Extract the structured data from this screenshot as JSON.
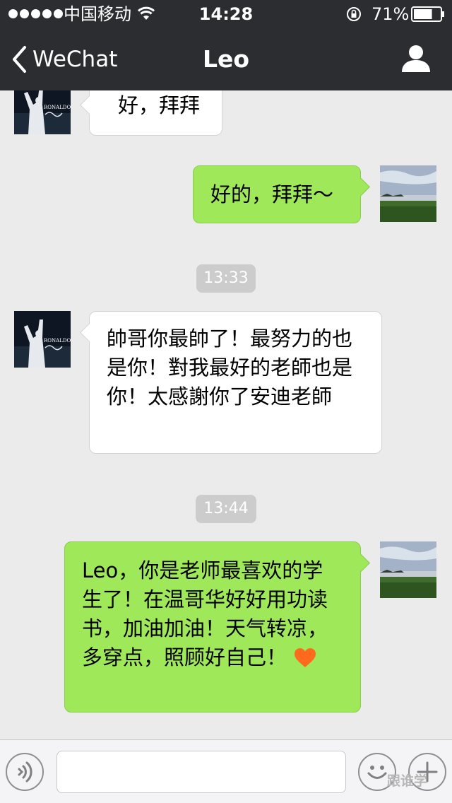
{
  "status_bar": {
    "carrier": "中国移动",
    "time": "14:28",
    "battery_percent": "71%",
    "battery_level": 0.71
  },
  "nav": {
    "back_label": "WeChat",
    "title": "Leo"
  },
  "messages": [
    {
      "from": "contact",
      "text": "好，拜拜"
    },
    {
      "from": "me",
      "text": "好的，拜拜～"
    },
    {
      "type": "time",
      "text": "13:33"
    },
    {
      "from": "contact",
      "text": "帥哥你最帥了！最努力的也是你！對我最好的老師也是你！太感謝你了安迪老師"
    },
    {
      "type": "time",
      "text": "13:44"
    },
    {
      "from": "me",
      "text": "Leo，你是老师最喜欢的学生了！在温哥华好好用功读书，加油加油！天气转凉，多穿点，照顾好自己！"
    }
  ],
  "contact_avatar_text": "RONALDO",
  "input": {
    "placeholder": ""
  },
  "watermark": "跟谁学",
  "colors": {
    "header_bg": "#2b2d31",
    "chat_bg": "#ebebeb",
    "outgoing_bubble": "#9ee85a",
    "incoming_bubble": "#ffffff",
    "time_badge": "#cccccc",
    "heart": "#ff6a1f"
  },
  "icons": {
    "back": "chevron-left-icon",
    "profile": "person-icon",
    "voice": "voice-icon",
    "emoji": "emoji-icon",
    "more": "plus-icon",
    "heart": "heart-emoji-icon"
  }
}
